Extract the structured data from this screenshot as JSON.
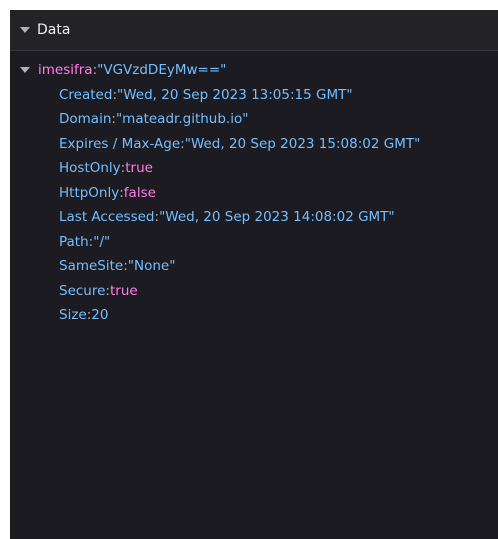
{
  "header": {
    "label": "Data"
  },
  "tree": {
    "root": {
      "key": "imesifra",
      "value": "\"VGVzdDEyMw==\""
    },
    "rows": [
      {
        "key": "Created",
        "value": "\"Wed, 20 Sep 2023 13:05:15 GMT\""
      },
      {
        "key": "Domain",
        "value": "\"mateadr.github.io\""
      },
      {
        "key": "Expires / Max-Age",
        "value": "\"Wed, 20 Sep 2023 15:08:02 GMT\""
      },
      {
        "key": "HostOnly",
        "value": "true"
      },
      {
        "key": "HttpOnly",
        "value": "false"
      },
      {
        "key": "Last Accessed",
        "value": "\"Wed, 20 Sep 2023 14:08:02 GMT\""
      },
      {
        "key": "Path",
        "value": "\"/\""
      },
      {
        "key": "SameSite",
        "value": "\"None\""
      },
      {
        "key": "Secure",
        "value": "true"
      },
      {
        "key": "Size",
        "value": "20"
      }
    ]
  },
  "colors": {
    "panel_background": "#1c1b22",
    "header_background": "#232327",
    "key_blue": "#75bfff",
    "key_pink": "#ff7de9"
  }
}
